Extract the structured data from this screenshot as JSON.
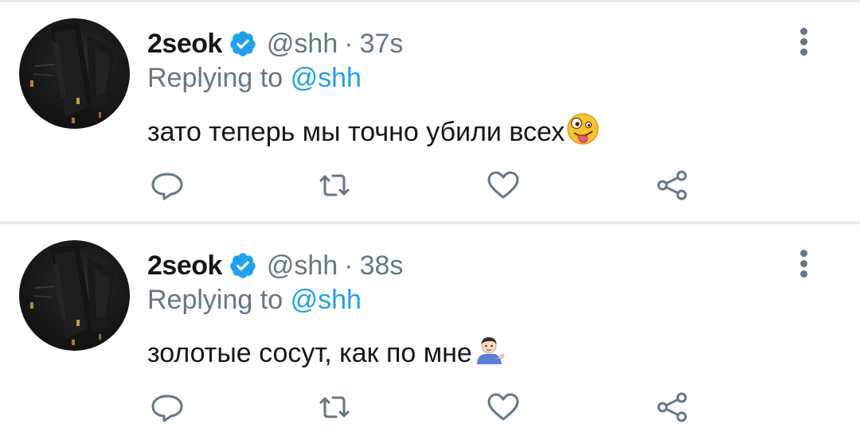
{
  "tweets": [
    {
      "author_name": "2seok",
      "handle": "@shh",
      "separator": "·",
      "time": "37s",
      "replying_prefix": "Replying to",
      "replying_to": "@shh",
      "text": "зато теперь мы точно убили всех",
      "emoji": "zany-face",
      "verified": true
    },
    {
      "author_name": "2seok",
      "handle": "@shh",
      "separator": "·",
      "time": "38s",
      "replying_prefix": "Replying to",
      "replying_to": "@shh",
      "text": "золотые сосут, как по мне",
      "emoji": "person-tipping-hand",
      "verified": true
    }
  ],
  "icons": [
    "reply-icon",
    "retweet-icon",
    "like-icon",
    "share-icon",
    "more-options-icon",
    "verified-badge-icon"
  ],
  "colors": {
    "text": "#14171a",
    "secondary": "#657786",
    "accent": "#1da1f2",
    "divider": "#e6ecf0"
  }
}
